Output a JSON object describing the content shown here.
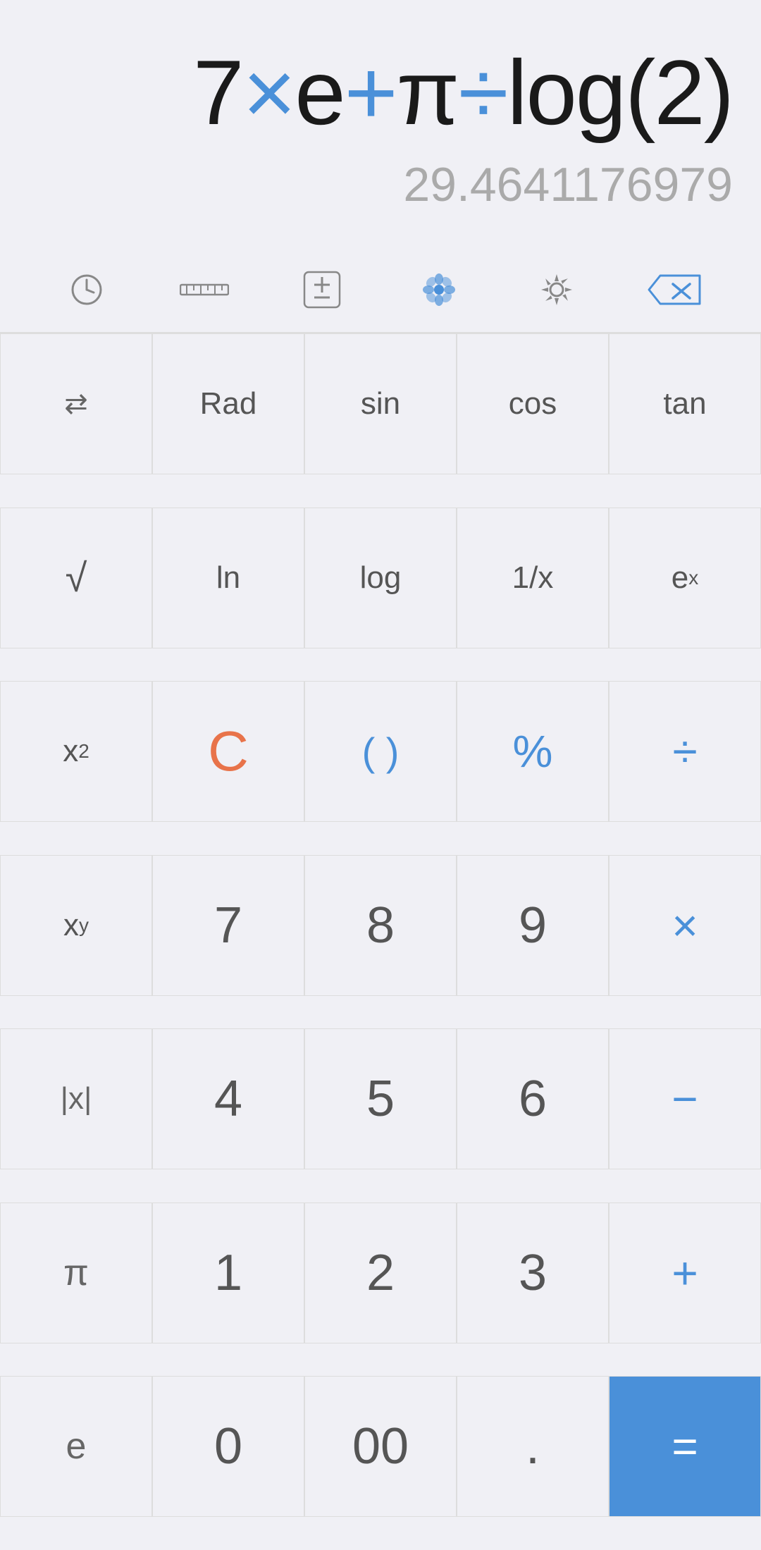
{
  "display": {
    "expression_parts": [
      {
        "text": "7",
        "type": "normal"
      },
      {
        "text": "×",
        "type": "blue"
      },
      {
        "text": "e",
        "type": "normal"
      },
      {
        "text": "+",
        "type": "blue"
      },
      {
        "text": "π",
        "type": "normal"
      },
      {
        "text": "÷",
        "type": "blue"
      },
      {
        "text": "log(2)",
        "type": "normal"
      }
    ],
    "expression_text": "7×e+π÷log(2)",
    "result": "29.4641176979"
  },
  "toolbar": {
    "history_label": "history",
    "ruler_label": "ruler",
    "plusminus_label": "plus-minus",
    "theme_label": "theme",
    "settings_label": "settings",
    "backspace_label": "⌫"
  },
  "keys": {
    "row1": [
      {
        "label": "⇄",
        "type": "normal",
        "name": "swap-key"
      },
      {
        "label": "Rad",
        "type": "normal",
        "name": "rad-key"
      },
      {
        "label": "sin",
        "type": "normal",
        "name": "sin-key"
      },
      {
        "label": "cos",
        "type": "normal",
        "name": "cos-key"
      },
      {
        "label": "tan",
        "type": "normal",
        "name": "tan-key"
      }
    ],
    "row2": [
      {
        "label": "√",
        "type": "normal",
        "name": "sqrt-key"
      },
      {
        "label": "ln",
        "type": "normal",
        "name": "ln-key"
      },
      {
        "label": "log",
        "type": "normal",
        "name": "log-key"
      },
      {
        "label": "1/x",
        "type": "normal",
        "name": "reciprocal-key"
      },
      {
        "label": "eˣ",
        "type": "superscript",
        "name": "ex-key"
      }
    ],
    "row3": [
      {
        "label": "x²",
        "type": "superscript",
        "name": "xsquared-key"
      },
      {
        "label": "C",
        "type": "orange",
        "name": "clear-key"
      },
      {
        "label": "( )",
        "type": "blue",
        "name": "parentheses-key"
      },
      {
        "label": "%",
        "type": "blue",
        "name": "percent-key"
      },
      {
        "label": "÷",
        "type": "operator",
        "name": "divide-key"
      }
    ],
    "row4": [
      {
        "label": "xʸ",
        "type": "superscript",
        "name": "xpow-key"
      },
      {
        "label": "7",
        "type": "normal",
        "name": "seven-key"
      },
      {
        "label": "8",
        "type": "normal",
        "name": "eight-key"
      },
      {
        "label": "9",
        "type": "normal",
        "name": "nine-key"
      },
      {
        "label": "×",
        "type": "operator",
        "name": "multiply-key"
      }
    ],
    "row5": [
      {
        "label": "|x|",
        "type": "normal",
        "name": "abs-key"
      },
      {
        "label": "4",
        "type": "normal",
        "name": "four-key"
      },
      {
        "label": "5",
        "type": "normal",
        "name": "five-key"
      },
      {
        "label": "6",
        "type": "normal",
        "name": "six-key"
      },
      {
        "label": "−",
        "type": "operator",
        "name": "minus-key"
      }
    ],
    "row6": [
      {
        "label": "π",
        "type": "normal",
        "name": "pi-key"
      },
      {
        "label": "1",
        "type": "normal",
        "name": "one-key"
      },
      {
        "label": "2",
        "type": "normal",
        "name": "two-key"
      },
      {
        "label": "3",
        "type": "normal",
        "name": "three-key"
      },
      {
        "label": "+",
        "type": "operator",
        "name": "plus-key"
      }
    ],
    "row7": [
      {
        "label": "e",
        "type": "normal",
        "name": "euler-key"
      },
      {
        "label": "0",
        "type": "normal",
        "name": "zero-key"
      },
      {
        "label": "00",
        "type": "normal",
        "name": "doublezero-key"
      },
      {
        "label": ".",
        "type": "normal",
        "name": "decimal-key"
      },
      {
        "label": "=",
        "type": "equals",
        "name": "equals-key"
      }
    ]
  },
  "colors": {
    "blue": "#4a90d9",
    "orange": "#e8734a",
    "background": "#f0f0f5",
    "equals_bg": "#4a90d9",
    "border": "#ddd",
    "text_normal": "#555",
    "text_light": "#aaa"
  }
}
